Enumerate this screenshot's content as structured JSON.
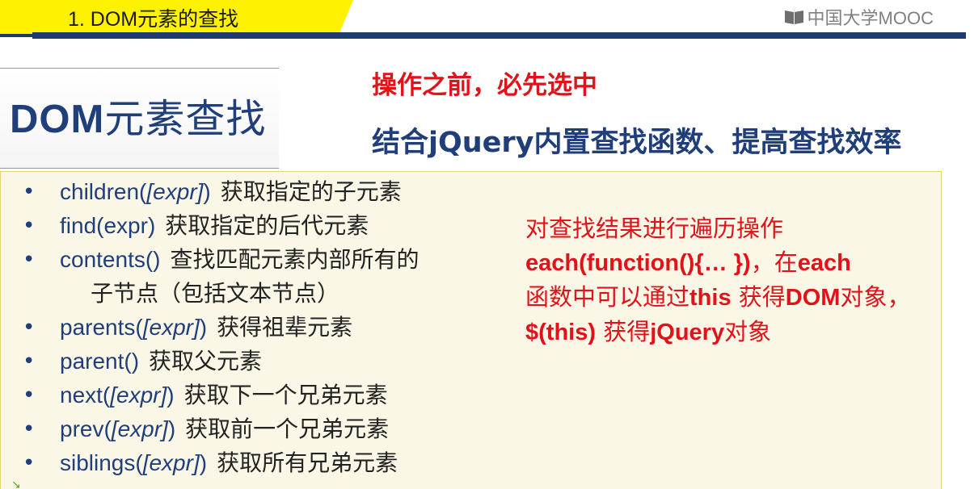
{
  "header": {
    "title": "1. DOM元素的查找",
    "logo_text": "中国大学MOOC"
  },
  "main_title": {
    "latin": "DOM",
    "cjk": "元素查找"
  },
  "headings": {
    "red": "操作之前，必先选中",
    "blue": "结合jQuery内置查找函数、提高查找效率"
  },
  "methods": [
    {
      "name": "children(",
      "param": "[expr]",
      "close": ")",
      "desc": "获取指定的子元素"
    },
    {
      "name": "find(expr)",
      "param": "",
      "close": "",
      "desc": "获取指定的后代元素"
    },
    {
      "name": "contents()",
      "param": "",
      "close": "",
      "desc": "查找匹配元素内部所有的"
    },
    {
      "name": "",
      "param": "",
      "close": "",
      "desc": "子节点（包括文本节点）"
    },
    {
      "name": "parents(",
      "param": "[expr]",
      "close": ")",
      "desc": "获得祖辈元素"
    },
    {
      "name": "parent()",
      "param": "",
      "close": "",
      "desc": "获取父元素"
    },
    {
      "name": "next(",
      "param": "[expr]",
      "close": ")",
      "desc": "获取下一个兄弟元素"
    },
    {
      "name": "prev(",
      "param": "[expr]",
      "close": ")",
      "desc": "获取前一个兄弟元素"
    },
    {
      "name": "siblings(",
      "param": "[expr]",
      "close": ")",
      "desc": "获取所有兄弟元素"
    }
  ],
  "note": {
    "line1": "对查找结果进行遍历操作",
    "each_code": "each(function(){… })",
    "comma": "，",
    "in_text": "在",
    "each_word": "each",
    "fn_text": "函数中可以通过",
    "this_word": "this",
    "get_text": " 获得",
    "dom_word": "DOM",
    "obj_text": "对象，",
    "jq_this": "$(this)",
    "get_text2": " 获得",
    "jquery_word": "jQuery",
    "obj_text2": "对象"
  },
  "colors": {
    "accent_yellow": "#fff200",
    "navy": "#1f3a6e",
    "title_blue": "#1f3e7a",
    "red": "#e0121a",
    "panel_bg": "#fbf7e6"
  }
}
